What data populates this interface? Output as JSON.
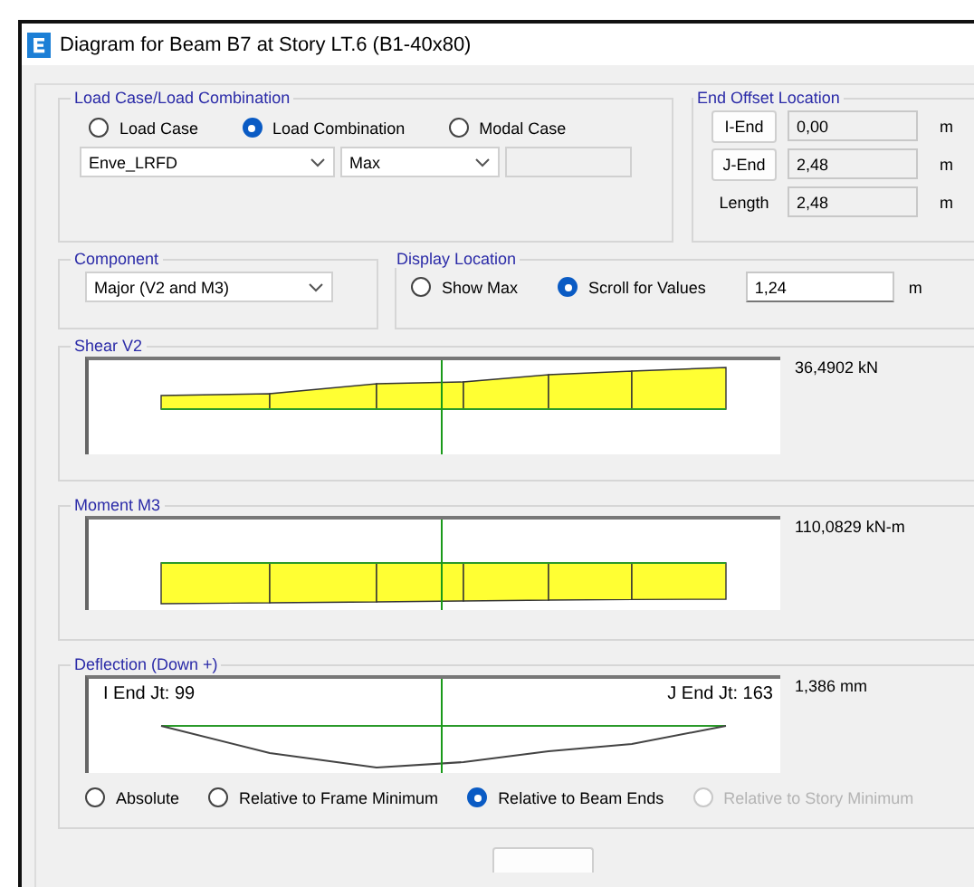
{
  "window": {
    "title": "Diagram for Beam B7 at Story LT.6 (B1-40x80)"
  },
  "load_case": {
    "legend": "Load Case/Load Combination",
    "options": [
      {
        "label": "Load Case",
        "selected": false
      },
      {
        "label": "Load Combination",
        "selected": true
      },
      {
        "label": "Modal Case",
        "selected": false
      }
    ],
    "combo": "Enve_LRFD",
    "type": "Max"
  },
  "end_offset": {
    "legend": "End Offset Location",
    "rows": [
      {
        "kind": "button",
        "label": "I-End",
        "value": "0,00",
        "unit": "m"
      },
      {
        "kind": "button",
        "label": "J-End",
        "value": "2,48",
        "unit": "m"
      },
      {
        "kind": "text",
        "label": "Length",
        "value": "2,48",
        "unit": "m"
      }
    ]
  },
  "component": {
    "legend": "Component",
    "value": "Major (V2 and M3)"
  },
  "display_location": {
    "legend": "Display Location",
    "options": [
      {
        "label": "Show Max",
        "selected": false
      },
      {
        "label": "Scroll for Values",
        "selected": true
      }
    ],
    "value": "1,24",
    "unit": "m"
  },
  "diagrams": [
    {
      "kind": "shear",
      "legend": "Shear V2",
      "reading": "36,4902 kN"
    },
    {
      "kind": "moment",
      "legend": "Moment M3",
      "reading": "110,0829 kN-m"
    },
    {
      "kind": "deflection",
      "legend": "Deflection (Down +)",
      "reading": "1,386 mm",
      "i_end": "I End Jt: 99",
      "j_end": "J End Jt: 163",
      "options": [
        {
          "label": "Absolute",
          "selected": false,
          "disabled": false
        },
        {
          "label": "Relative to Frame Minimum",
          "selected": false,
          "disabled": false
        },
        {
          "label": "Relative to Beam Ends",
          "selected": true,
          "disabled": false
        },
        {
          "label": "Relative to Story Minimum",
          "selected": false,
          "disabled": true
        }
      ]
    }
  ]
}
